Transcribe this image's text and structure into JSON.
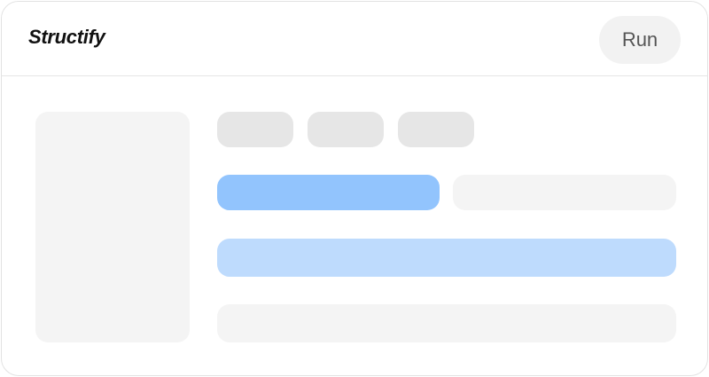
{
  "header": {
    "brand": "Structify",
    "run_label": "Run"
  },
  "colors": {
    "primary_bar": "#92c4fd",
    "wide_bar": "#bedbfd",
    "chip": "#e6e6e6",
    "placeholder": "#f4f4f4",
    "run_button_bg": "#f2f2f2"
  }
}
